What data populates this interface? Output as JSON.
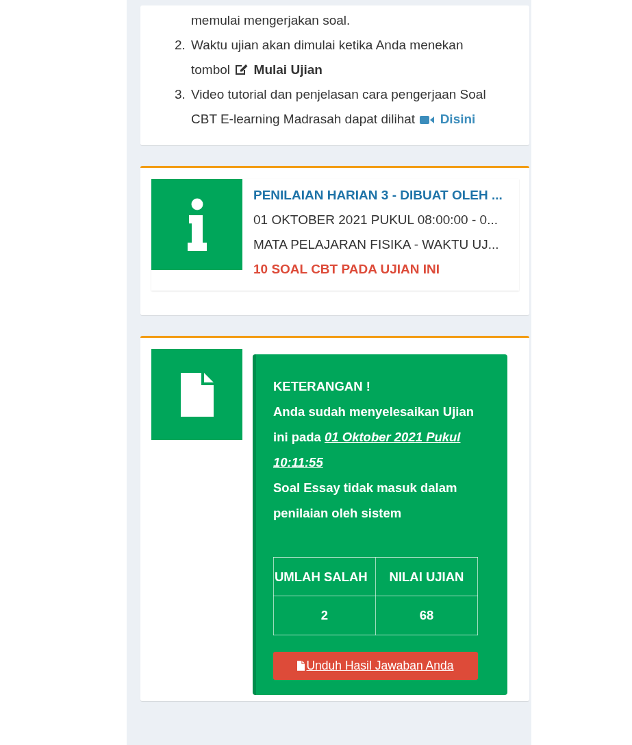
{
  "instructions": [
    {
      "kind": "plain",
      "lines": [
        "memulai mengerjakan soal."
      ]
    },
    {
      "kind": "button_ref",
      "number": "2.",
      "lines": [
        "Waktu ujian akan dimulai ketika Anda menekan",
        "tombol"
      ],
      "ref": "Mulai Ujian"
    },
    {
      "kind": "link",
      "number": "3.",
      "lines": [
        "Video tutorial dan penjelasan cara pengerjaan Soal",
        "CBT E-learning Madrasah dapat dilihat"
      ],
      "ref": "Disini"
    }
  ],
  "exam_info": {
    "title": "PENILAIAN HARIAN 3 - DIBUAT OLEH ...",
    "schedule": "01 OKTOBER 2021 PUKUL 08:00:00 - 0...",
    "subject": "MATA PELAJARAN FISIKA - WAKTU UJ...",
    "question_count": "10 SOAL CBT PADA UJIAN INI"
  },
  "result": {
    "heading": "KETERANGAN !",
    "completed_text": "Anda sudah menyelesaikan Ujian ini pada",
    "completed_at": "01 Oktober 2021 Pukul 10:11:55",
    "note": "Soal Essay tidak masuk dalam penilaian oleh sistem",
    "table": {
      "columns": [
        "UMLAH SALAH",
        "NILAI UJIAN"
      ],
      "rows": [
        [
          "2",
          "68"
        ]
      ]
    },
    "download_button": "Unduh Hasil Jawaban Anda"
  }
}
